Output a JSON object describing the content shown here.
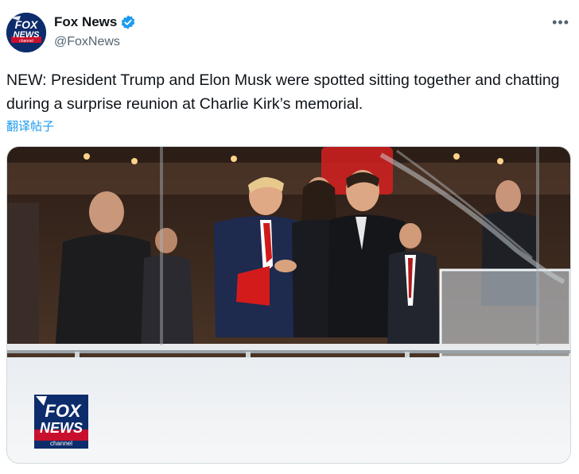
{
  "post": {
    "author_name": "Fox News",
    "author_handle": "@FoxNews",
    "verified": true,
    "more_label": "•••",
    "text": "NEW: President Trump and Elon Musk were spotted sitting together and chatting during a surprise reunion at Charlie Kirk’s memorial.",
    "translate_label": "翻译帖子"
  },
  "avatar": {
    "line1": "FOX",
    "line2": "NEWS",
    "line3": "channel"
  },
  "video_logo": {
    "line1": "FOX",
    "line2": "NEWS",
    "line3": "channel"
  },
  "colors": {
    "verified_blue": "#1d9bf0",
    "link_blue": "#1d9bf0",
    "fox_navy": "#0d2c6b",
    "fox_red": "#c8102e"
  },
  "icons": [
    "verified-badge-icon",
    "more-options-icon"
  ]
}
